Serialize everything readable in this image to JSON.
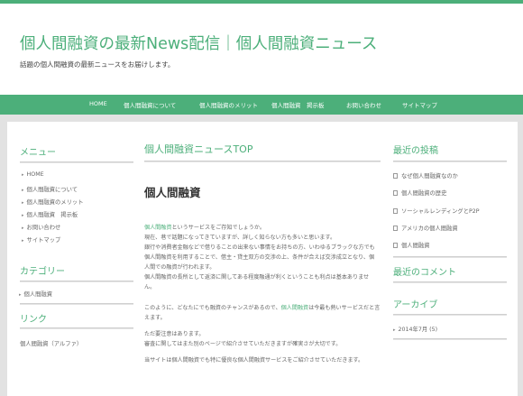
{
  "header": {
    "title": "個人間融資の最新News配信｜個人間融資ニュース",
    "description": "話題の個人間融資の最新ニュースをお届けします。"
  },
  "nav": {
    "items": [
      "HOME",
      "個人間融資について",
      "個人間融資のメリット",
      "個人間融資　掲示板",
      "お問い合わせ",
      "サイトマップ"
    ]
  },
  "left_sidebar": {
    "menu_heading": "メニュー",
    "menu_items": [
      "HOME",
      "個人間融資について",
      "個人間融資のメリット",
      "個人間融資　掲示板",
      "お問い合わせ",
      "サイトマップ"
    ],
    "category_heading": "カテゴリー",
    "category_items": [
      "個人間融資"
    ],
    "links_heading": "リンク",
    "links_items": [
      "個人間融資（アルファ）"
    ]
  },
  "main": {
    "heading": "個人間融資ニュースTOP",
    "post_title": "個人間融資",
    "p1_link": "個人間融資",
    "p1_rest": "というサービスをご存知でしょうか。",
    "p2": "現在、巷で話題になってきていますが、詳しく知らない方も多いと思います。",
    "p3": "銀行や消費者金融などで借りることの出来ない事情をお持ちの方、いわゆるブラックな方でも",
    "p4": "個人間融資を利用することで、借主・貸主双方の交渉の上、条件が合えば交渉成立となり、個",
    "p5": "人間での融資が行われます。",
    "p6": "個人間融資の長所として返済に関してある程度融通が利くということも利点は基本ありませ",
    "p7": "ん。",
    "p8_start": "このように、どなたにでも融資のチャンスがあるので、",
    "p8_link": "個人間融資",
    "p8_end": "は今最も熱いサービスだと言",
    "p9": "えます。",
    "p10": "ただ要注意はあります。",
    "p11": "審査に関してはまた別のページで紹介させていただきますが確実さが大切です。",
    "p12": "当サイトは個人間融資でも特に優良な個人間融資サービスをご紹介させていただきます。"
  },
  "right_sidebar": {
    "recent_posts_heading": "最近の投稿",
    "recent_posts": [
      "なぜ個人間融資なのか",
      "個人間融資の歴史",
      "ソーシャルレンディングとP2P",
      "アメリカの個人間融資",
      "個人間融資"
    ],
    "recent_comments_heading": "最近のコメント",
    "archive_heading": "アーカイブ",
    "archive_items": [
      "2014年7月 (5)"
    ]
  },
  "colors": {
    "accent": "#4caf7a",
    "background": "#e2e2e2"
  }
}
